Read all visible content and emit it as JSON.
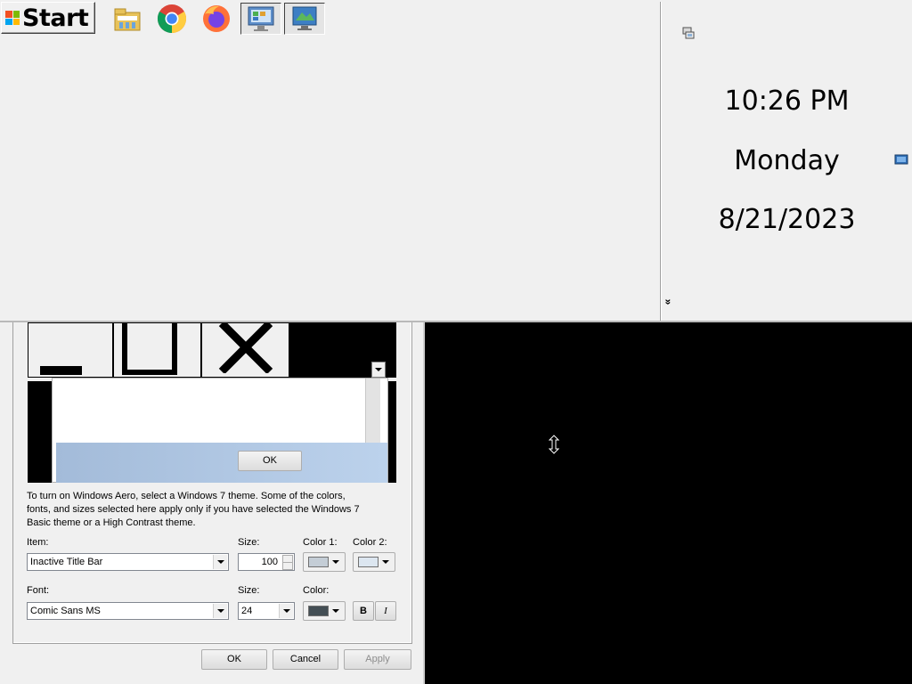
{
  "taskbar": {
    "start_label": "Start",
    "quick_launch": [
      {
        "name": "file-explorer-icon"
      },
      {
        "name": "chrome-icon"
      },
      {
        "name": "firefox-icon"
      },
      {
        "name": "control-panel-icon"
      },
      {
        "name": "show-desktop-icon"
      }
    ]
  },
  "tray": {
    "time": "10:26 PM",
    "day": "Monday",
    "date": "8/21/2023",
    "expand_glyph": "»"
  },
  "preview": {
    "ok_label": "OK"
  },
  "appearance": {
    "info_text_1": "To turn on Windows Aero, select a Windows 7 theme.  Some of the colors,",
    "info_text_2": "fonts, and sizes selected here apply only if you have selected the Windows 7",
    "info_text_3": "Basic theme or a High Contrast theme.",
    "item_label": "Item:",
    "item_value": "Inactive Title Bar",
    "item_size_label": "Size:",
    "item_size_value": "100",
    "color1_label": "Color 1:",
    "color1_value": "#c4cdd6",
    "color2_label": "Color 2:",
    "color2_value": "#dce6f0",
    "font_label": "Font:",
    "font_value": "Comic Sans MS",
    "font_size_label": "Size:",
    "font_size_value": "24",
    "font_color_label": "Color:",
    "font_color_value": "#434e54",
    "bold_label": "B",
    "italic_label": "I"
  },
  "buttons": {
    "ok": "OK",
    "cancel": "Cancel",
    "apply": "Apply"
  }
}
